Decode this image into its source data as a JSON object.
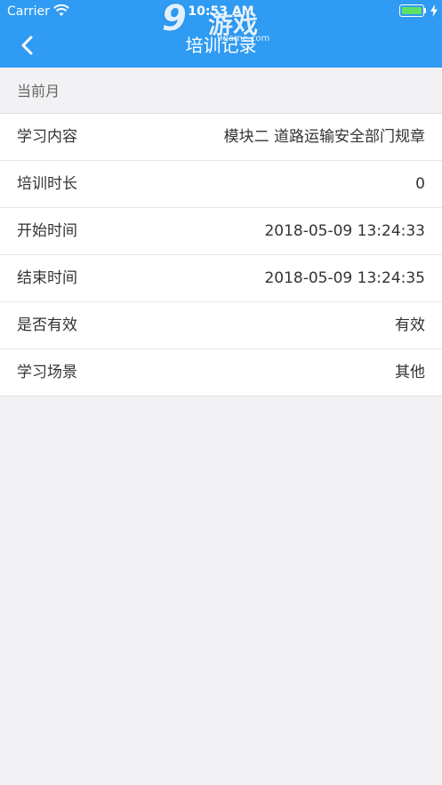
{
  "status_bar": {
    "carrier": "Carrier",
    "time": "10:53 AM",
    "battery_color": "#5ee067"
  },
  "watermark": {
    "number": "9",
    "text": "游戏",
    "url": "9game.com"
  },
  "nav": {
    "title": "培训记录",
    "back_icon": "chevron-left-icon",
    "background": "#2f9bf2"
  },
  "section": {
    "label": "当前月"
  },
  "rows": [
    {
      "label": "学习内容",
      "value": "模块二 道路运输安全部门规章"
    },
    {
      "label": "培训时长",
      "value": "0"
    },
    {
      "label": "开始时间",
      "value": "2018-05-09 13:24:33"
    },
    {
      "label": "结束时间",
      "value": "2018-05-09 13:24:35"
    },
    {
      "label": "是否有效",
      "value": "有效"
    },
    {
      "label": "学习场景",
      "value": "其他"
    }
  ]
}
